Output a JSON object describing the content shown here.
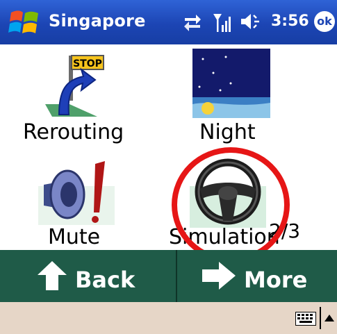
{
  "titlebar": {
    "title": "Singapore",
    "time": "3:56",
    "ok_label": "ok"
  },
  "tiles": [
    {
      "label": "Rerouting",
      "icon": "rerouting-icon",
      "sign_text": "STOP"
    },
    {
      "label": "Night",
      "icon": "night-icon"
    },
    {
      "label": "Mute",
      "icon": "mute-icon"
    },
    {
      "label": "Simulation",
      "icon": "steering-wheel-icon"
    }
  ],
  "page_indicator": "2/3",
  "softkeys": {
    "back_label": "Back",
    "more_label": "More"
  },
  "colors": {
    "titlebar_blue": "#1c45b4",
    "softkey_green": "#1f5b48",
    "highlight_red": "#e61616",
    "taskbar_tan": "#e6d6c7"
  }
}
